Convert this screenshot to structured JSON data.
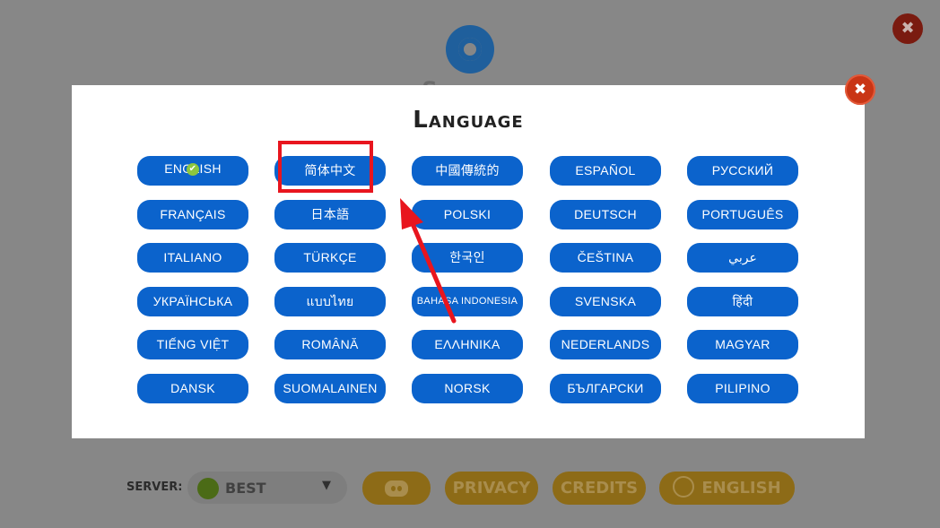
{
  "background": {
    "title": "Settings"
  },
  "modal": {
    "title": "Language",
    "close_symbol": "✖",
    "languages": [
      [
        "ENGLISH",
        "简体中文",
        "中國傳統的",
        "ESPAÑOL",
        "РУССКИЙ"
      ],
      [
        "FRANÇAIS",
        "日本語",
        "POLSKI",
        "DEUTSCH",
        "PORTUGUÊS"
      ],
      [
        "ITALIANO",
        "TÜRKÇE",
        "한국인",
        "ČEŠTINA",
        "عربي"
      ],
      [
        "УКРАЇНСЬКА",
        "แบบไทย",
        "BAHASA INDONESIA",
        "SVENSKA",
        "हिंदी"
      ],
      [
        "TIẾNG VIỆT",
        "ROMÂNĂ",
        "ΕΛΛΗΝΙΚΑ",
        "NEDERLANDS",
        "MAGYAR"
      ],
      [
        "DANSK",
        "SUOMALAINEN",
        "NORSK",
        "БЪЛГАРСКИ",
        "PILIPINO"
      ]
    ],
    "selected": "ENGLISH",
    "check_symbol": "✔"
  },
  "footer": {
    "server_label": "SERVER:",
    "server_value": "BEST",
    "server_arrow": "▼",
    "privacy": "PRIVACY",
    "credits": "CREDITS",
    "language": "ENGLISH"
  },
  "outer_close_symbol": "✖",
  "icons": {
    "settings": "gear-icon",
    "discord": "discord-icon",
    "language": "globe-icon",
    "close": "close-icon"
  },
  "colors": {
    "language_button": "#0b63cc",
    "close_button": "#c93515",
    "annotation": "#e8151e",
    "selected_check": "#8dc63f"
  }
}
